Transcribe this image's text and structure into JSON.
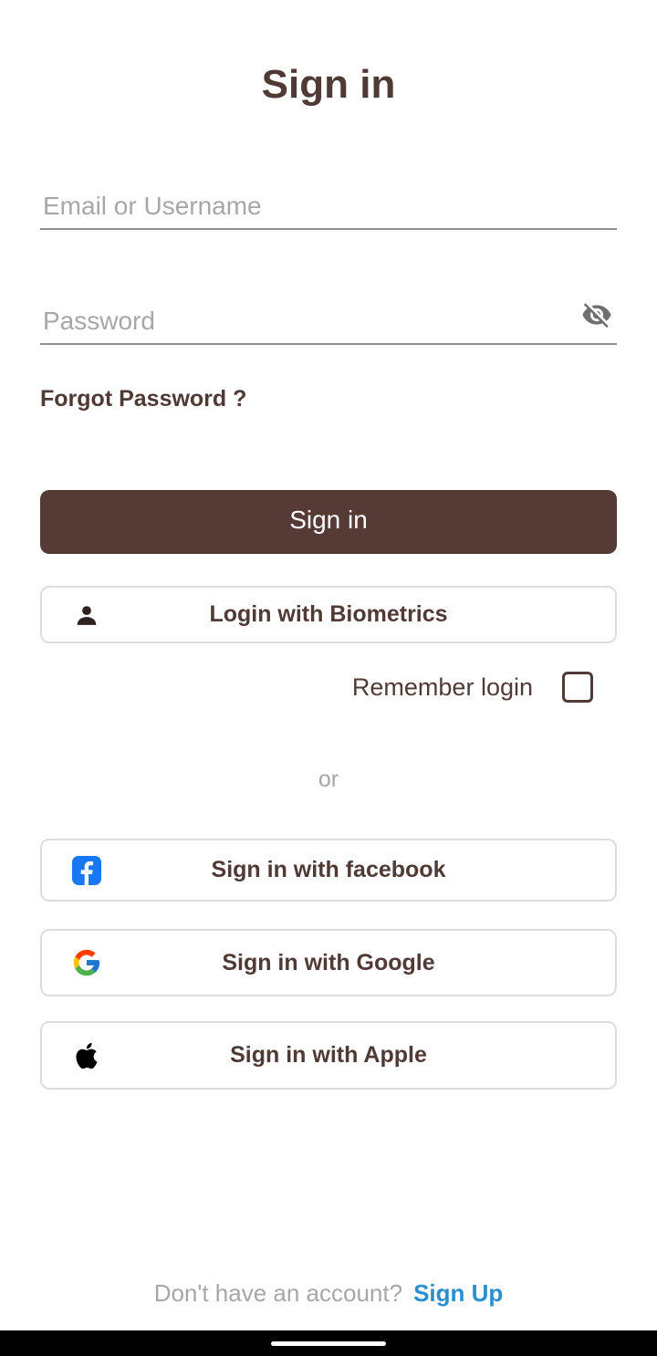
{
  "header": {
    "title": "Sign in"
  },
  "form": {
    "email_placeholder": "Email or Username",
    "email_value": "",
    "password_placeholder": "Password",
    "password_value": "",
    "password_toggle_icon": "eye-off-icon",
    "forgot_password": "Forgot Password ?",
    "submit_label": "Sign in",
    "biometrics_label": "Login with Biometrics",
    "biometrics_icon": "person-icon",
    "remember_label": "Remember login",
    "remember_checked": false
  },
  "separator": {
    "text": "or"
  },
  "social": {
    "facebook_label": "Sign in with facebook",
    "facebook_icon": "facebook-icon",
    "google_label": "Sign in with Google",
    "google_icon": "google-icon",
    "apple_label": "Sign in with Apple",
    "apple_icon": "apple-icon"
  },
  "footer": {
    "prompt": "Don't have an account?",
    "signup_label": "Sign Up"
  },
  "colors": {
    "primary": "#553a36",
    "text": "#503a36",
    "placeholder": "#a7a7a7",
    "link": "#2a8fcf",
    "border": "#e1dcdb",
    "facebook": "#1877f2"
  }
}
